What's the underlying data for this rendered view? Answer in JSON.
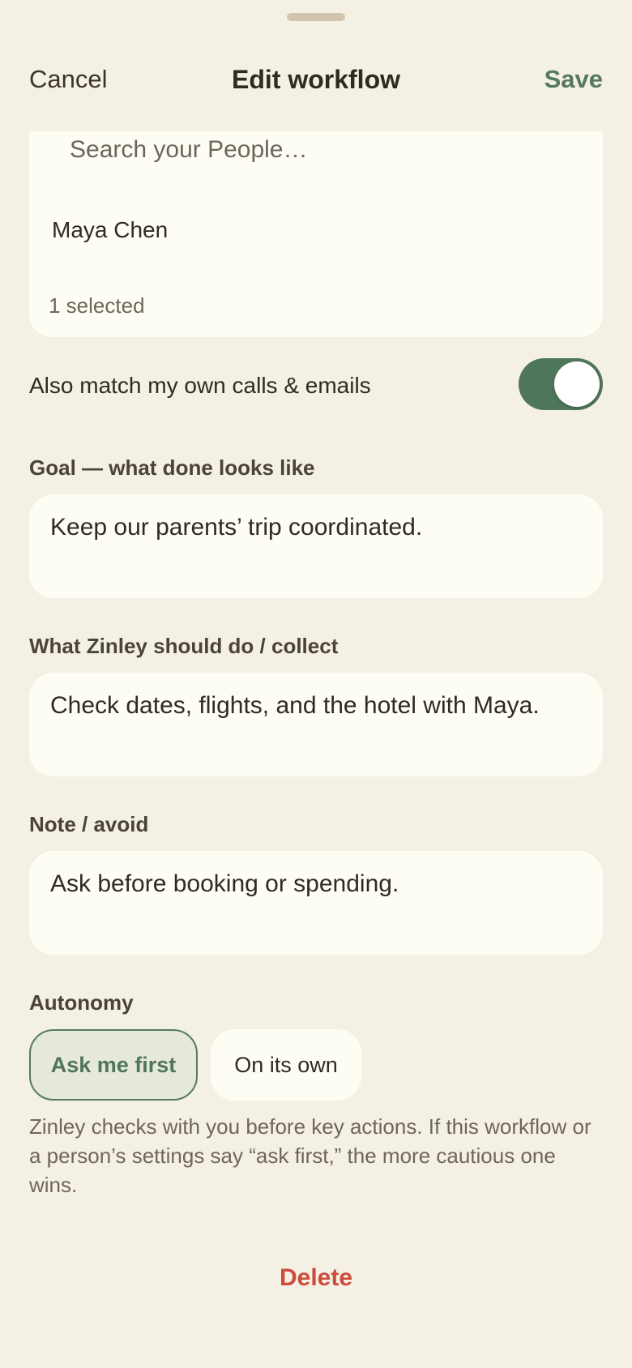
{
  "nav": {
    "cancel_label": "Cancel",
    "title": "Edit workflow",
    "save_label": "Save"
  },
  "people": {
    "search_placeholder": "Search your People…",
    "selected_person": "Maya Chen",
    "selected_count": "1 selected"
  },
  "match_own": {
    "label": "Also match my own calls & emails",
    "enabled": true
  },
  "goal": {
    "label": "Goal — what done looks like",
    "value": "Keep our parents’ trip coordinated."
  },
  "instructions": {
    "label": "What Zinley should do / collect",
    "value": "Check dates, flights, and the hotel with Maya."
  },
  "note": {
    "label": "Note / avoid",
    "value": "Ask before booking or spending."
  },
  "autonomy": {
    "label": "Autonomy",
    "options": [
      "Ask me first",
      "On its own"
    ],
    "selected": "Ask me first",
    "description": "Zinley checks with you before key actions. If this workflow or a person’s settings say “ask first,” the more cautious one wins."
  },
  "delete_label": "Delete",
  "colors": {
    "accent": "#557a5f",
    "danger": "#cd4b3c",
    "background": "#f5f0e4",
    "card": "#fefdf4"
  }
}
